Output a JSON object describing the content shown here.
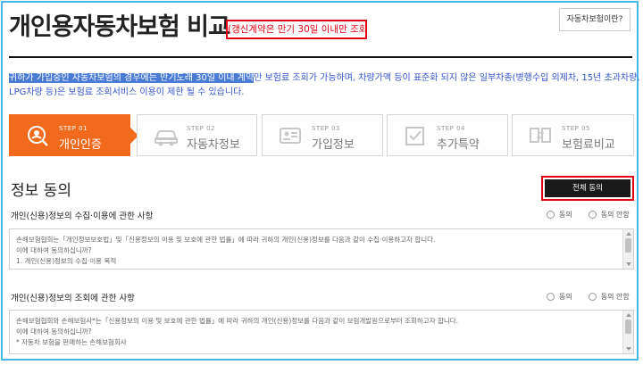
{
  "header": {
    "title": "개인용자동차보험 비교",
    "renewal_note": "(갱신계약은 만기 30일 이내만 조회)",
    "what_button": "자동차보험이란?"
  },
  "notice": {
    "highlight": "귀하가 가입중인 자동차보험의 경우에는 만기도래 30일 이내 계약",
    "line1_rest": "만 보험료 조회가 가능하며, 차량가액 등이 표준화 되지 않은 일부차종(병행수입 외제차, 15년 초과차량,",
    "line2": "LPG차량 등)은 보험료 조회서비스 이용이 제한 될 수 있습니다."
  },
  "steps": [
    {
      "num": "STEP 01",
      "label": "개인인증",
      "icon": "search-person-icon"
    },
    {
      "num": "STEP 02",
      "label": "자동차정보",
      "icon": "car-icon"
    },
    {
      "num": "STEP 03",
      "label": "가입정보",
      "icon": "id-card-icon"
    },
    {
      "num": "STEP 04",
      "label": "추가특약",
      "icon": "checkbox-icon"
    },
    {
      "num": "STEP 05",
      "label": "보험료비교",
      "icon": "compare-icon"
    }
  ],
  "consent": {
    "section_title": "정보 동의",
    "agree_all_button": "전체 동의",
    "agree_label": "동의",
    "disagree_label": "동의 안함",
    "items": [
      {
        "title": "개인(신용)정보의 수집·이용에 관한 사항",
        "lines": [
          "손해보험협회는「개인정보보호법」및「신용정보의 이용 및 보호에 관한 법률」에 따라 귀하의 개인(신용)정보를 다음과 같이 수집·이용하고자 합니다.",
          "이에 대하여 동의하십니까?",
          "1. 개인(신용)정보의 수집·이용 목적"
        ]
      },
      {
        "title": "개인(신용)정보의 조회에 관한 사항",
        "lines": [
          "손해보험협회와 손해보험사*는「신용정보의 이용 및 보호에 관한 법률」에 따라 귀하의 개인(신용)정보를 다음과 같이 보험개발원으로부터 조회하고자 합니다.",
          "이에 대하여 동의하십니까?",
          "* 자동차 보험을 판매하는 손해보험회사"
        ]
      }
    ]
  },
  "colors": {
    "accent": "#f26a1b",
    "notice_text": "#3355cc",
    "highlight_bg": "#4a7cd6",
    "alert_red": "#e00012",
    "frame": "#49b6e6"
  }
}
